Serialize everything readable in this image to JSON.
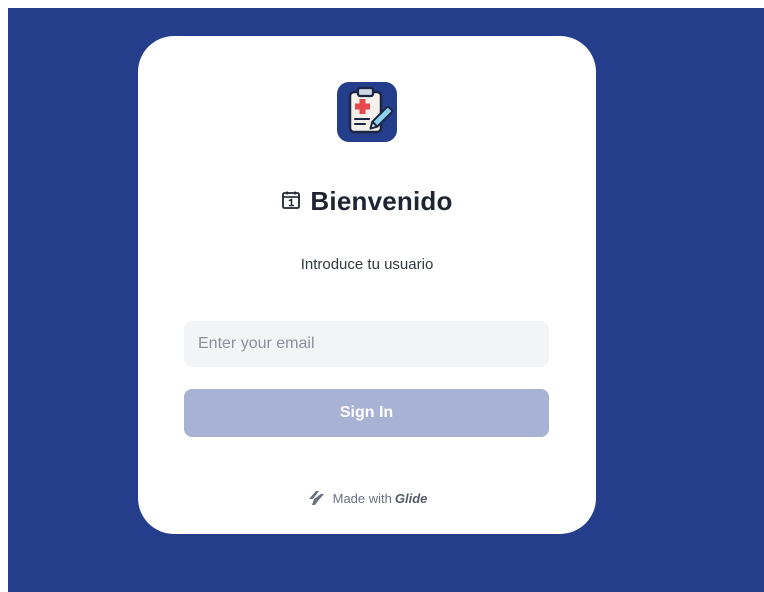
{
  "login": {
    "title": "Bienvenido",
    "title_emoji": "calendar-icon",
    "subtitle": "Introduce tu usuario",
    "email_placeholder": "Enter your email",
    "email_value": "",
    "sign_in_label": "Sign In"
  },
  "footer": {
    "made_with": "Made with",
    "brand": "Glide"
  },
  "app_icon": {
    "name": "medical-clipboard-icon"
  },
  "colors": {
    "background": "#253e8c",
    "card": "#ffffff",
    "button_disabled": "#a7b2d4",
    "input_bg": "#f3f4f6"
  }
}
